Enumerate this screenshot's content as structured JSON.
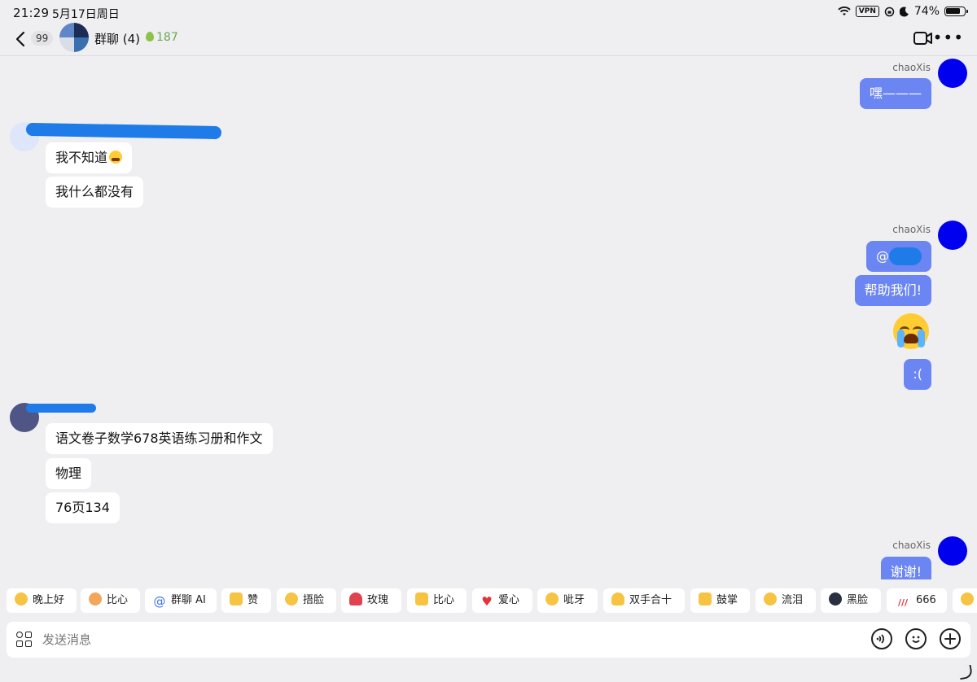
{
  "status_bar": {
    "time": "21:29",
    "date": "5月17日周日",
    "vpn": "VPN",
    "battery": "74%"
  },
  "header": {
    "unread_count": "99",
    "title": "群聊 (4)",
    "fire_count": "187"
  },
  "messages": {
    "m1": {
      "sender": "chaoXis",
      "text": "嘿———"
    },
    "m2": {
      "text": "我不知道"
    },
    "m3": {
      "text": "我什么都没有"
    },
    "m4": {
      "sender": "chaoXis",
      "text": "@"
    },
    "m5": {
      "text": "帮助我们!"
    },
    "m6": {
      "emoji": "loudly-crying-face"
    },
    "m7": {
      "text": ":("
    },
    "m8": {
      "text": "语文卷子数学678英语练习册和作文"
    },
    "m9": {
      "text": "物理"
    },
    "m10": {
      "text": "76页134"
    },
    "m11": {
      "sender": "chaoXis",
      "text": "谢谢!"
    }
  },
  "reactions": [
    {
      "label": "晚上好",
      "icon": "star-face-icon",
      "color": "#f6c343"
    },
    {
      "label": "比心",
      "icon": "heart-hands-icon",
      "color": "#f2a65a"
    },
    {
      "label": "群聊 AI",
      "icon": "at-icon",
      "color": "#3b6ef5"
    },
    {
      "label": "赞",
      "icon": "thumbs-up-icon",
      "color": "#f6c343"
    },
    {
      "label": "捂脸",
      "icon": "facepalm-icon",
      "color": "#f6c343"
    },
    {
      "label": "玫瑰",
      "icon": "rose-icon",
      "color": "#e0434f"
    },
    {
      "label": "比心",
      "icon": "finger-heart-icon",
      "color": "#f6c343"
    },
    {
      "label": "爱心",
      "icon": "heart-icon",
      "color": "#e5323b"
    },
    {
      "label": "呲牙",
      "icon": "grin-icon",
      "color": "#f6c343"
    },
    {
      "label": "双手合十",
      "icon": "pray-icon",
      "color": "#f6c343"
    },
    {
      "label": "鼓掌",
      "icon": "clap-icon",
      "color": "#f6c343"
    },
    {
      "label": "流泪",
      "icon": "crying-icon",
      "color": "#f6c343"
    },
    {
      "label": "黑脸",
      "icon": "dark-face-icon",
      "color": "#2b3040"
    },
    {
      "label": "666",
      "icon": "666-icon",
      "color": "#e5323b"
    }
  ],
  "input": {
    "placeholder": "发送消息"
  },
  "colors": {
    "background": "#efeff1",
    "bubble_out": "#6b86f2",
    "bubble_in": "#ffffff",
    "my_avatar": "#0000ee",
    "redaction": "#1e7be8"
  }
}
